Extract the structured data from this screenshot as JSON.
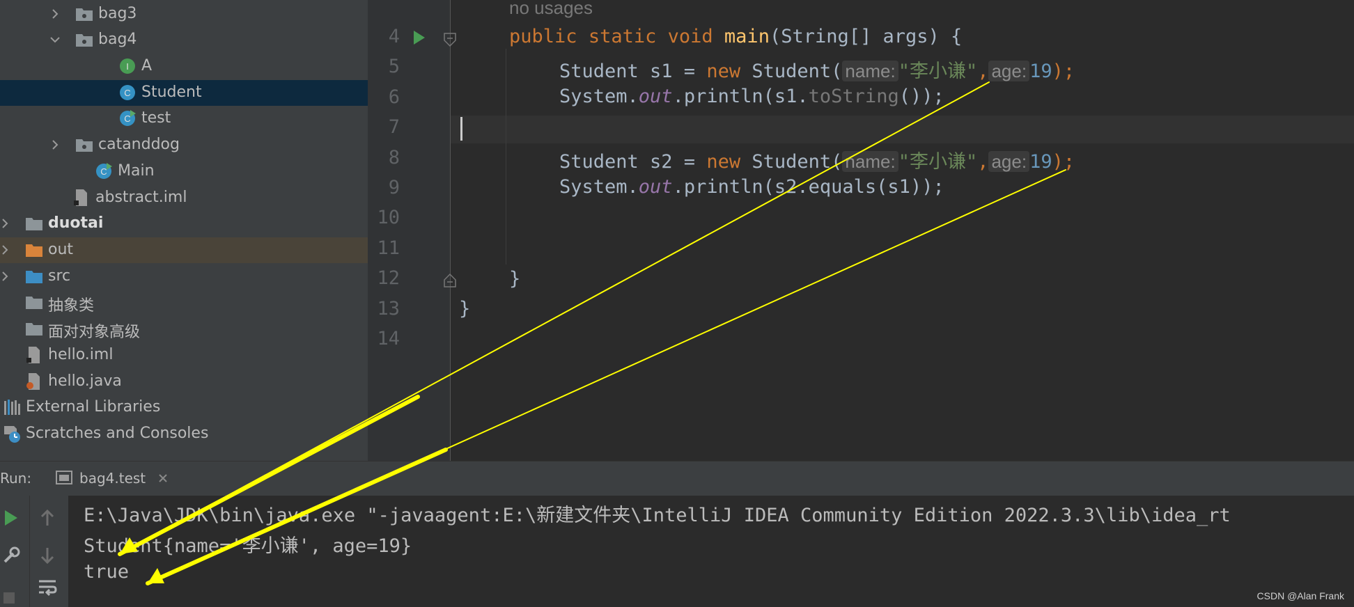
{
  "project_tree": [
    {
      "label": "bag3",
      "type": "package",
      "expanded": false
    },
    {
      "label": "bag4",
      "type": "package",
      "expanded": true
    },
    {
      "label": "A",
      "type": "interface"
    },
    {
      "label": "Student",
      "type": "class",
      "selected": true
    },
    {
      "label": "test",
      "type": "class-runnable"
    },
    {
      "label": "catanddog",
      "type": "package",
      "expanded": false
    },
    {
      "label": "Main",
      "type": "class-runnable"
    },
    {
      "label": "abstract.iml",
      "type": "iml-file"
    },
    {
      "label": "duotai",
      "type": "module",
      "expanded": false
    },
    {
      "label": "out",
      "type": "excluded-folder",
      "expanded": false
    },
    {
      "label": "src",
      "type": "source-folder",
      "expanded": false
    },
    {
      "label": "抽象类",
      "type": "folder"
    },
    {
      "label": "面对对象高级",
      "type": "folder"
    },
    {
      "label": "hello.iml",
      "type": "iml-file"
    },
    {
      "label": "hello.java",
      "type": "java-file"
    },
    {
      "label": "External Libraries",
      "type": "libraries",
      "expanded": false
    },
    {
      "label": "Scratches and Consoles",
      "type": "scratches"
    }
  ],
  "editor": {
    "usages_hint": "no usages",
    "line_numbers": [
      "4",
      "5",
      "6",
      "7",
      "8",
      "9",
      "10",
      "11",
      "12",
      "13",
      "14"
    ],
    "code": {
      "l4_public": "public",
      "l4_static": "static",
      "l4_void": "void",
      "l4_main": "main",
      "l4_rest": "(String[] args) {",
      "l5_a": "Student s1 = ",
      "l5_new": "new",
      "l5_b": " Student(",
      "hint_name": "name:",
      "l5_str": "\"李小谦\"",
      "comma": ",",
      "hint_age": "age:",
      "l5_num": "19",
      "close": ");",
      "l6_a": "System.",
      "out": "out",
      "l6_b": ".println(s1.",
      "l6_tostring": "toString",
      "l6_c": "());",
      "l8_a": "Student s2 = ",
      "l8_str": "\"李小谦\"",
      "l8_num": "19",
      "l9_b": ".println(s2.equals(s1));",
      "l12": "}",
      "l13": "}"
    }
  },
  "run_panel": {
    "label": "Run:",
    "tab_label": "bag4.test",
    "console": [
      "E:\\Java\\JDK\\bin\\java.exe \"-javaagent:E:\\新建文件夹\\IntelliJ IDEA Community Edition 2022.3.3\\lib\\idea_rt",
      "Student{name='李小谦', age=19}",
      "true"
    ]
  },
  "watermark": "CSDN @Alan Frank",
  "colors": {
    "arrow": "#ffff00",
    "keyword": "#cc7832",
    "string": "#6a8759",
    "number": "#6897bb",
    "selection": "#0d293e"
  }
}
